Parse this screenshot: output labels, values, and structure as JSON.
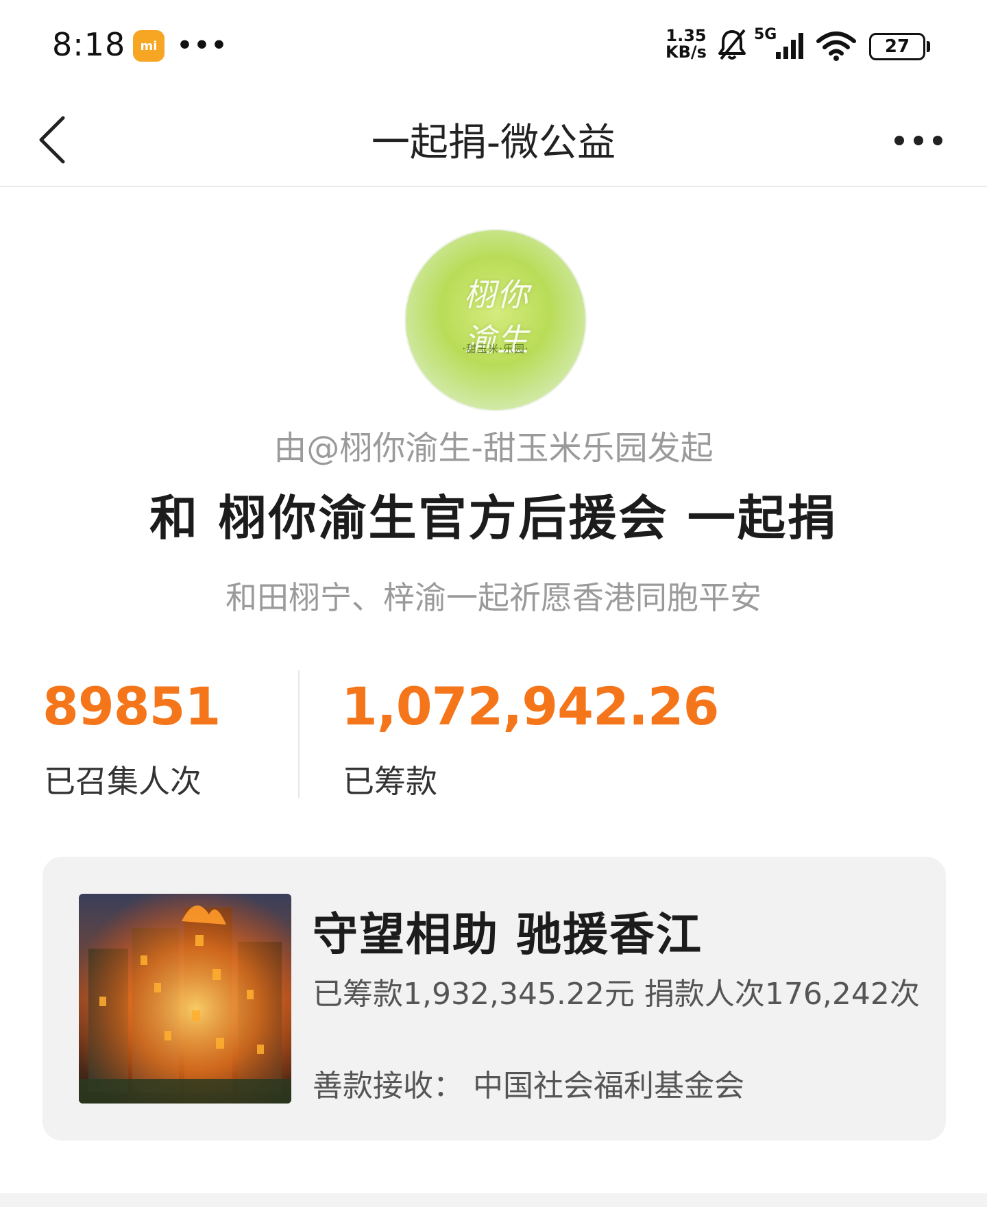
{
  "status_bar": {
    "time": "8:18",
    "app_icon": "mi",
    "more": "•••",
    "net_speed_value": "1.35",
    "net_speed_unit": "KB/s",
    "network": "5G",
    "battery": "27"
  },
  "header": {
    "title": "一起捐-微公益"
  },
  "avatar": {
    "script_text": "栩你渝生",
    "sub_text": "·甜玉米·乐园·"
  },
  "initiator": "由@栩你渝生-甜玉米乐园发起",
  "campaign": {
    "title": "和 栩你渝生官方后援会 一起捐",
    "subtitle": "和田栩宁、梓渝一起祈愿香港同胞平安"
  },
  "stats": {
    "people_value": "89851",
    "people_label": "已召集人次",
    "amount_value": "1,072,942.26",
    "amount_label": "已筹款"
  },
  "project": {
    "title": "守望相助 驰援香江",
    "stats": "已筹款1,932,345.22元  捐款人次176,242次",
    "receiver": "善款接收：  中国社会福利基金会"
  },
  "colors": {
    "accent": "#f5761a",
    "card_bg": "#f2f2f2"
  }
}
